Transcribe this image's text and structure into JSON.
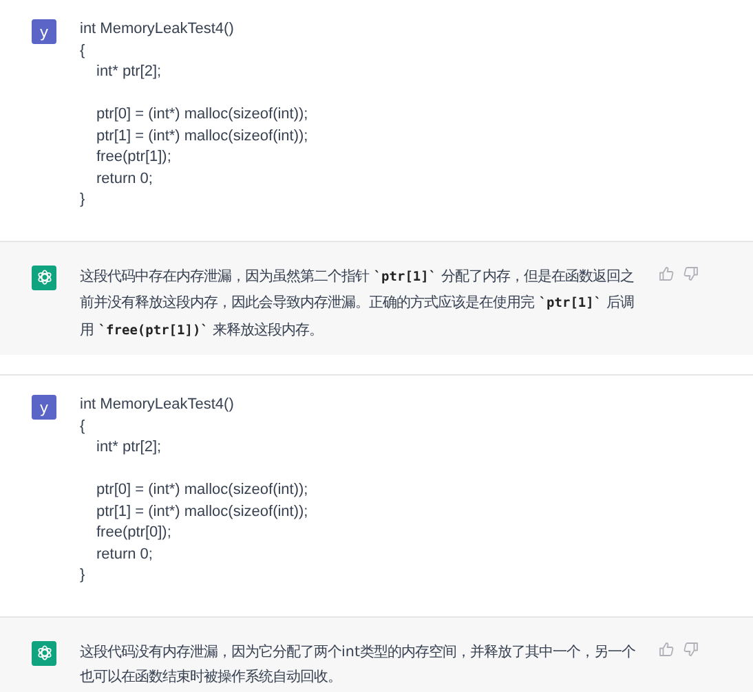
{
  "messages": [
    {
      "kind": "user",
      "avatar": "y",
      "paragraphs": [
        {
          "lines": [
            {
              "text": "int MemoryLeakTest4()",
              "indented": false
            },
            {
              "text": "{",
              "indented": false
            },
            {
              "text": "int* ptr[2];",
              "indented": true
            }
          ]
        },
        {
          "lines": [
            {
              "text": "ptr[0] = (int*) malloc(sizeof(int));",
              "indented": true
            },
            {
              "text": "ptr[1] = (int*) malloc(sizeof(int));",
              "indented": true
            },
            {
              "text": "free(ptr[1]);",
              "indented": true
            },
            {
              "text": "return 0;",
              "indented": true
            },
            {
              "text": "}",
              "indented": false
            }
          ]
        }
      ]
    },
    {
      "kind": "assistant",
      "text": "这段代码中存在内存泄漏，因为虽然第二个指针 **`ptr[1]`** 分配了内存，但是在函数返回之前并没有释放这段内存，因此会导致内存泄漏。正确的方式应该是在使用完 **`ptr[1]`** 后调用 **`free(ptr[1])`** 来释放这段内存。"
    },
    {
      "kind": "user",
      "avatar": "y",
      "paragraphs": [
        {
          "lines": [
            {
              "text": "int MemoryLeakTest4()",
              "indented": false
            },
            {
              "text": "{",
              "indented": false
            },
            {
              "text": "int* ptr[2];",
              "indented": true
            }
          ]
        },
        {
          "lines": [
            {
              "text": "ptr[0] = (int*) malloc(sizeof(int));",
              "indented": true
            },
            {
              "text": "ptr[1] = (int*) malloc(sizeof(int));",
              "indented": true
            },
            {
              "text": "free(ptr[0]);",
              "indented": true
            },
            {
              "text": "return 0;",
              "indented": true
            },
            {
              "text": "}",
              "indented": false
            }
          ]
        }
      ]
    },
    {
      "kind": "assistant",
      "text": "这段代码没有内存泄漏，因为它分配了两个int类型的内存空间，并释放了其中一个，另一个也可以在函数结束时被操作系统自动回收。"
    }
  ]
}
